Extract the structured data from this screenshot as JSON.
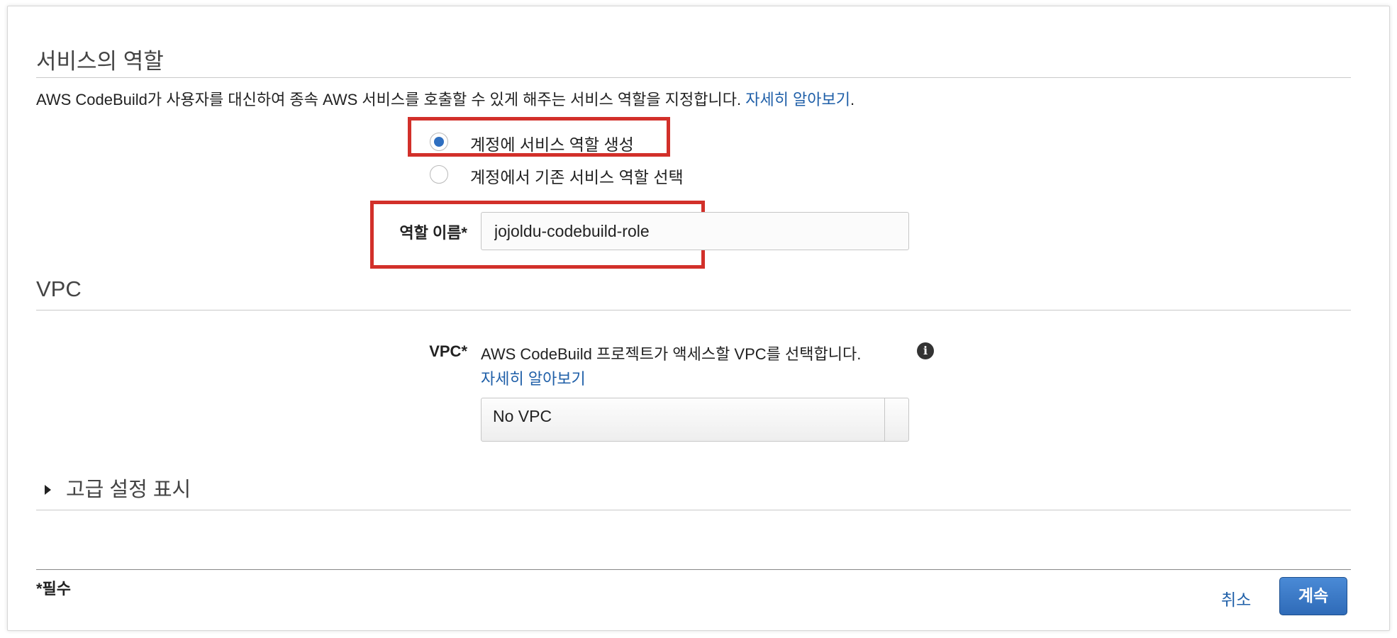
{
  "service_role": {
    "heading": "서비스의 역할",
    "description": "AWS CodeBuild가 사용자를 대신하여 종속 AWS 서비스를 호출할 수 있게 해주는 서비스 역할을 지정합니다.",
    "learn_more": "자세히 알아보기",
    "period": ".",
    "options": [
      {
        "label": "계정에 서비스 역할 생성",
        "selected": true
      },
      {
        "label": "계정에서 기존 서비스 역할 선택",
        "selected": false
      }
    ],
    "role_name_label": "역할 이름*",
    "role_name_value": "jojoldu-codebuild-role"
  },
  "vpc": {
    "heading": "VPC",
    "label": "VPC*",
    "help_text": "AWS CodeBuild 프로젝트가 액세스할 VPC를 선택합니다.",
    "learn_more": "자세히 알아보기",
    "select_value": "No VPC",
    "info_icon": "info-icon"
  },
  "advanced": {
    "label": "고급 설정 표시",
    "icon": "caret-right-icon"
  },
  "footer": {
    "required_note": "*필수",
    "cancel_label": "취소",
    "continue_label": "계속"
  },
  "colors": {
    "link": "#1f5fa8",
    "primary_button": "#2f6bb8",
    "highlight_box": "#d2302a",
    "radio_selected": "#2f6fc0"
  }
}
